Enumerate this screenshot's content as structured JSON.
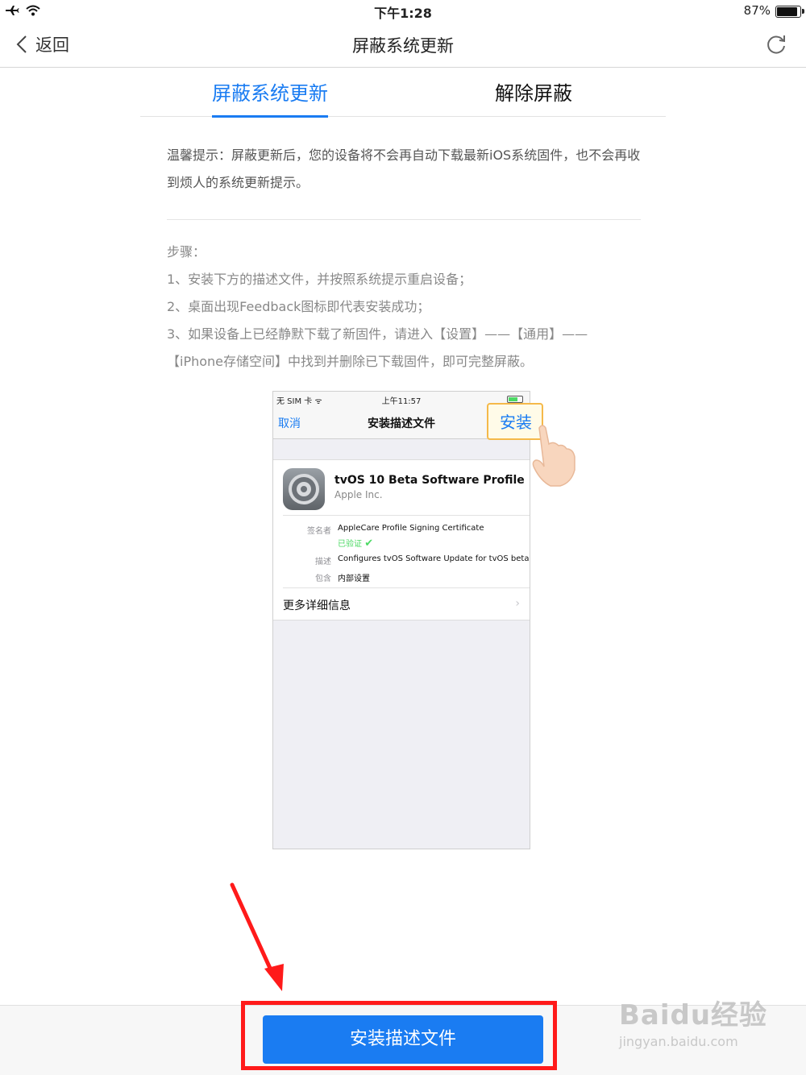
{
  "status_bar": {
    "time": "下午1:28",
    "battery": "87%",
    "battery_level": 0.87
  },
  "nav": {
    "back_label": "返回",
    "title": "屏蔽系统更新"
  },
  "tabs": [
    {
      "label": "屏蔽系统更新",
      "active": true
    },
    {
      "label": "解除屏蔽",
      "active": false
    }
  ],
  "tip": "温馨提示：屏蔽更新后，您的设备将不会再自动下载最新iOS系统固件，也不会再收到烦人的系统更新提示。",
  "steps": {
    "heading": "步骤：",
    "items": [
      "1、安装下方的描述文件，并按照系统提示重启设备；",
      "2、桌面出现Feedback图标即代表安装成功；",
      "3、如果设备上已经静默下载了新固件，请进入【设置】——【通用】——",
      "【iPhone存储空间】中找到并删除已下载固件，即可完整屏蔽。"
    ]
  },
  "screenshot": {
    "carrier": "无 SIM 卡",
    "time": "上午11:57",
    "cancel": "取消",
    "title": "安装描述文件",
    "install": "安装",
    "profile_name": "tvOS 10 Beta Software Profile",
    "vendor": "Apple Inc.",
    "signed_by_label": "签名者",
    "signed_by": "AppleCare Profile Signing Certificate",
    "verified": "已验证",
    "desc_label": "描述",
    "desc": "Configures tvOS Software Update for tvOS beta",
    "contains_label": "包含",
    "contains": "内部设置",
    "more_info": "更多详细信息"
  },
  "install_button": "安装描述文件",
  "watermark": {
    "brand": "Baidu经验",
    "url": "jingyan.baidu.com"
  },
  "colors": {
    "accent": "#1a7cf2",
    "highlight": "#ff1a1a",
    "verified": "#4cd964"
  }
}
